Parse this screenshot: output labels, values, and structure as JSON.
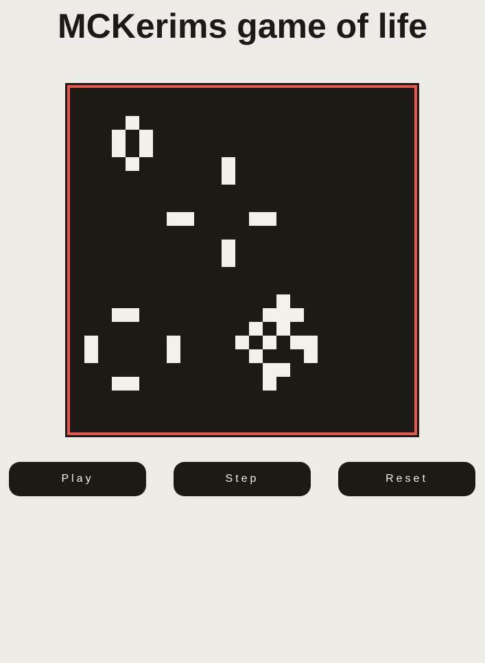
{
  "title": "MCKerims game of life",
  "board": {
    "cols": 25,
    "rows": 25,
    "colors": {
      "background": "#1d1a16",
      "border": "#e8574e",
      "alive": "#f2f0eb"
    },
    "alive_cells": [
      [
        4,
        2
      ],
      [
        3,
        3
      ],
      [
        5,
        3
      ],
      [
        3,
        4
      ],
      [
        5,
        4
      ],
      [
        4,
        5
      ],
      [
        11,
        5
      ],
      [
        11,
        6
      ],
      [
        7,
        9
      ],
      [
        8,
        9
      ],
      [
        13,
        9
      ],
      [
        14,
        9
      ],
      [
        11,
        11
      ],
      [
        11,
        12
      ],
      [
        15,
        15
      ],
      [
        14,
        16
      ],
      [
        15,
        16
      ],
      [
        16,
        16
      ],
      [
        3,
        16
      ],
      [
        4,
        16
      ],
      [
        13,
        17
      ],
      [
        15,
        17
      ],
      [
        12,
        18
      ],
      [
        14,
        18
      ],
      [
        16,
        18
      ],
      [
        17,
        18
      ],
      [
        13,
        19
      ],
      [
        17,
        19
      ],
      [
        1,
        18
      ],
      [
        1,
        19
      ],
      [
        7,
        18
      ],
      [
        7,
        19
      ],
      [
        3,
        21
      ],
      [
        4,
        21
      ],
      [
        14,
        20
      ],
      [
        15,
        20
      ],
      [
        14,
        21
      ]
    ]
  },
  "controls": {
    "play_label": "Play",
    "step_label": "Step",
    "reset_label": "Reset"
  }
}
